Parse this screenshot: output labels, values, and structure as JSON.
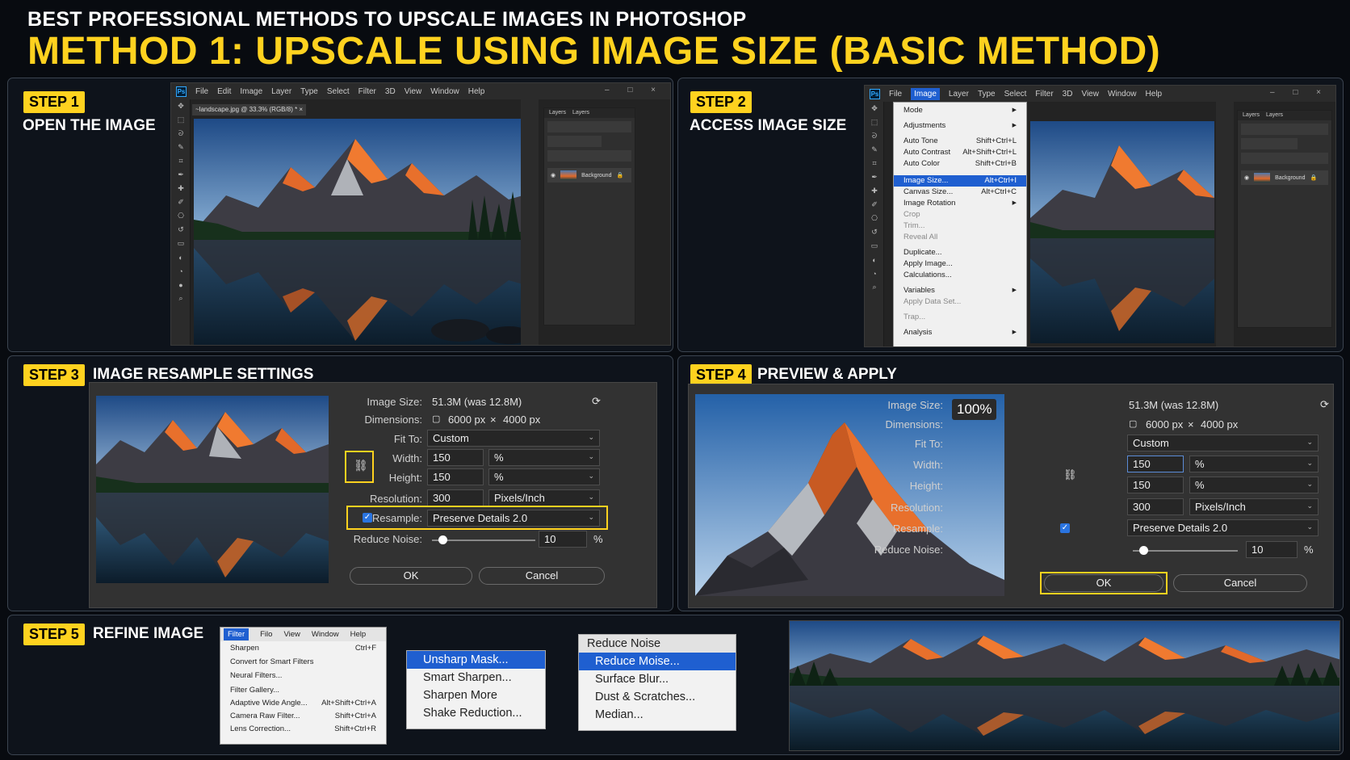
{
  "header": {
    "subtitle": "BEST PROFESSIONAL METHODS TO UPSCALE IMAGES IN PHOTOSHOP",
    "title": "METHOD 1: UPSCALE USING IMAGE SIZE (BASIC METHOD)"
  },
  "colors": {
    "accent": "#ffd21f",
    "menu_selection": "#1f5fd0",
    "photoshop_blue": "#31a8ff"
  },
  "step1": {
    "badge": "STEP 1",
    "title": "OPEN THE IMAGE",
    "menu": [
      "File",
      "Edit",
      "Image",
      "Layer",
      "Type",
      "Select",
      "Filter",
      "3D",
      "View",
      "Window",
      "Help"
    ],
    "doc_tab": "~landscape.jpg @ 33.3% (RGB/8) *  ×",
    "layers_tabs": [
      "Layers",
      "Layers"
    ],
    "layer_name": "Background",
    "window_controls": "– □ ×"
  },
  "step2": {
    "badge": "STEP 2",
    "title": "ACCESS IMAGE SIZE",
    "menu": [
      "File",
      "Image",
      "Layer",
      "Type",
      "Select",
      "Filter",
      "3D",
      "View",
      "Window",
      "Help"
    ],
    "layers_tabs": [
      "Layers",
      "Layers"
    ],
    "layer_name": "Background",
    "window_controls": "– □ ×",
    "dropdown": {
      "mode": "Mode",
      "adjustments": "Adjustments",
      "auto_tone": "Auto Tone",
      "auto_tone_key": "Shift+Ctrl+L",
      "auto_contrast": "Auto Contrast",
      "auto_contrast_key": "Alt+Shift+Ctrl+L",
      "auto_color": "Auto Color",
      "auto_color_key": "Shift+Ctrl+B",
      "image_size": "Image Size...",
      "image_size_key": "Alt+Ctrl+I",
      "canvas_size": "Canvas Size...",
      "canvas_size_key": "Alt+Ctrl+C",
      "image_rotation": "Image Rotation",
      "crop": "Crop",
      "trim": "Trim...",
      "reveal_all": "Reveal All",
      "duplicate": "Duplicate...",
      "apply_image": "Apply Image...",
      "calculations": "Calculations...",
      "variables": "Variables",
      "apply_data_set": "Apply Data Set...",
      "trap": "Trap...",
      "analysis": "Analysis"
    }
  },
  "step3": {
    "badge": "STEP 3",
    "title": "IMAGE RESAMPLE SETTINGS",
    "dialog": {
      "image_size_label": "Image Size:",
      "image_size_value": "51.3M (was 12.8M)",
      "dimensions_label": "Dimensions:",
      "dim_w": "6000 px",
      "dim_x": "×",
      "dim_h": "4000 px",
      "fit_to_label": "Fit To:",
      "fit_to_value": "Custom",
      "width_label": "Width:",
      "width_value": "150",
      "width_unit": "%",
      "height_label": "Height:",
      "height_value": "150",
      "height_unit": "%",
      "resolution_label": "Resolution:",
      "resolution_value": "300",
      "resolution_unit": "Pixels/Inch",
      "resample_label": "Resample:",
      "resample_value": "Preserve Details 2.0",
      "noise_label": "Reduce Noise:",
      "noise_value": "10",
      "noise_unit": "%",
      "noise_fraction": 0.1,
      "ok": "OK",
      "cancel": "Cancel"
    }
  },
  "step4": {
    "badge": "STEP 4",
    "title": "PREVIEW & APPLY",
    "zoom": "100%",
    "dialog": {
      "image_size_label": "Image Size:",
      "image_size_value": "51.3M (was 12.8M)",
      "dimensions_label": "Dimensions:",
      "dim_w": "6000 px",
      "dim_x": "×",
      "dim_h": "4000 px",
      "fit_to_label": "Fit To:",
      "fit_to_value": "Custom",
      "width_label": "Width:",
      "width_value": "150",
      "width_unit": "%",
      "height_label": "Height:",
      "height_value": "150",
      "height_unit": "%",
      "resolution_label": "Resolution:",
      "resolution_value": "300",
      "resolution_unit": "Pixels/Inch",
      "resample_label": "Resample:",
      "resample_value": "Preserve Details 2.0",
      "noise_label": "Reduce Noise:",
      "noise_value": "10",
      "noise_unit": "%",
      "noise_fraction": 0.1,
      "ok": "OK",
      "cancel": "Cancel"
    }
  },
  "step5": {
    "badge": "STEP 5",
    "title": "REFINE IMAGE",
    "filter_menu_bar": [
      "Filter",
      "Filo",
      "View",
      "Window",
      "Help"
    ],
    "filter_items": [
      {
        "label": "Sharpen",
        "key": "Ctrl+F"
      },
      {
        "label": "Convert for Smart Filters",
        "key": ""
      },
      {
        "label": "Neural Filters...",
        "key": ""
      },
      {
        "label": "Filter Gallery...",
        "key": ""
      },
      {
        "label": "Adaptive Wide Angle...",
        "key": "Alt+Shift+Ctrl+A"
      },
      {
        "label": "Camera Raw Filter...",
        "key": "Shift+Ctrl+A"
      },
      {
        "label": "Lens Correction...",
        "key": "Shift+Ctrl+R"
      }
    ],
    "sharpen_submenu": [
      "Unsharp Mask...",
      "Smart Sharpen...",
      "Sharpen More",
      "Shake Reduction..."
    ],
    "noise_header": "Reduce Noise",
    "noise_submenu": [
      "Reduce Moise...",
      "Surface Blur...",
      "Dust & Scratches...",
      "Median..."
    ]
  }
}
